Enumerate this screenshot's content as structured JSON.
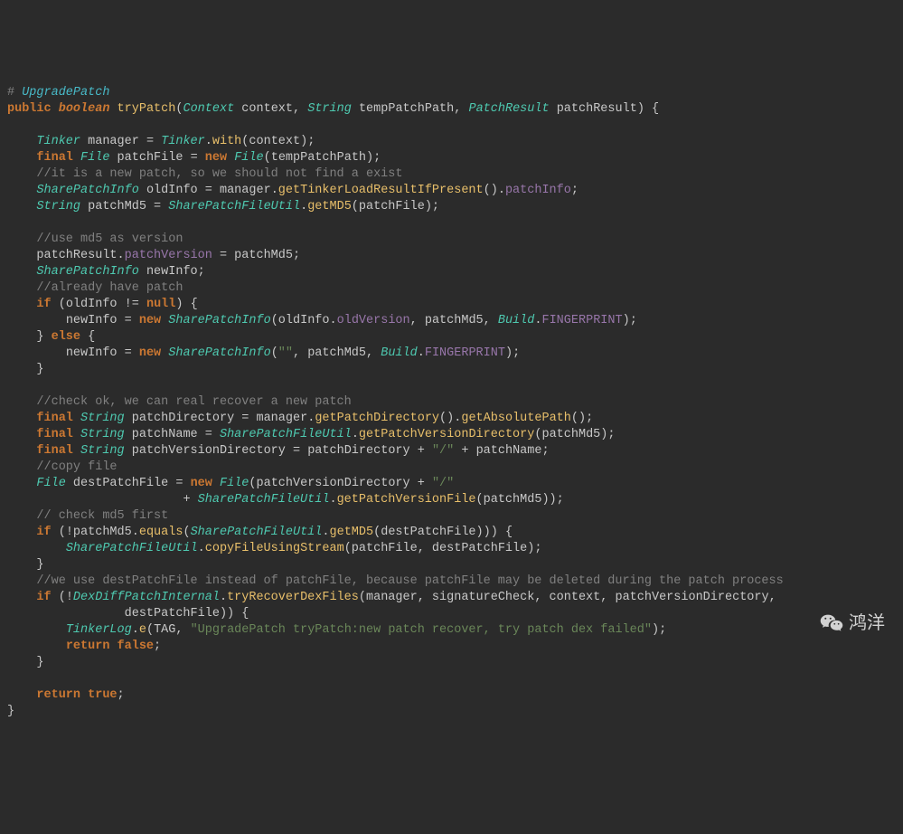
{
  "title_hash": "# ",
  "title": "UpgradePatch",
  "sig": {
    "public": "public",
    "boolean": "boolean",
    "fn": "tryPatch",
    "ctx_t": "Context",
    "ctx": "context",
    "str_t": "String",
    "tpp": "tempPatchPath",
    "pr_t": "PatchResult",
    "pr": "patchResult"
  },
  "kw": {
    "final": "final",
    "new": "new",
    "if": "if",
    "else": "else",
    "return": "return",
    "null": "null"
  },
  "t": {
    "Tinker": "Tinker",
    "File": "File",
    "SharePatchInfo": "SharePatchInfo",
    "String": "String",
    "SharePatchFileUtil": "SharePatchFileUtil",
    "Build": "Build",
    "DexDiffPatchInternal": "DexDiffPatchInternal",
    "TinkerLog": "TinkerLog"
  },
  "v": {
    "manager": "manager",
    "context": "context",
    "patchFile": "patchFile",
    "tempPatchPath": "tempPatchPath",
    "oldInfo": "oldInfo",
    "patchMd5": "patchMd5",
    "patchResult": "patchResult",
    "patchVersion": "patchVersion",
    "newInfo": "newInfo",
    "oldVersion": "oldVersion",
    "FINGERPRINT": "FINGERPRINT",
    "patchDirectory": "patchDirectory",
    "patchName": "patchName",
    "patchVersionDirectory": "patchVersionDirectory",
    "destPatchFile": "destPatchFile",
    "signatureCheck": "signatureCheck",
    "TAG": "TAG",
    "patchInfo": "patchInfo"
  },
  "m": {
    "with": "with",
    "getTinkerLoadResultIfPresent": "getTinkerLoadResultIfPresent",
    "getMD5": "getMD5",
    "getPatchDirectory": "getPatchDirectory",
    "getAbsolutePath": "getAbsolutePath",
    "getPatchVersionDirectory": "getPatchVersionDirectory",
    "getPatchVersionFile": "getPatchVersionFile",
    "equals": "equals",
    "copyFileUsingStream": "copyFileUsingStream",
    "tryRecoverDexFiles": "tryRecoverDexFiles",
    "e": "e"
  },
  "s": {
    "empty": "\"\"",
    "slash": "\"/\"",
    "logmsg": "\"UpgradePatch tryPatch:new patch recover, try patch dex failed\"",
    "false": "false",
    "true": "true"
  },
  "c": {
    "c1": "//it is a new patch, so we should not find a exist",
    "c2": "//use md5 as version",
    "c3": "//already have patch",
    "c4": "//check ok, we can real recover a new patch",
    "c5": "//copy file",
    "c6": "// check md5 first",
    "c7": "//we use destPatchFile instead of patchFile, because patchFile may be deleted during the patch process"
  },
  "watermark": "鸿洋"
}
